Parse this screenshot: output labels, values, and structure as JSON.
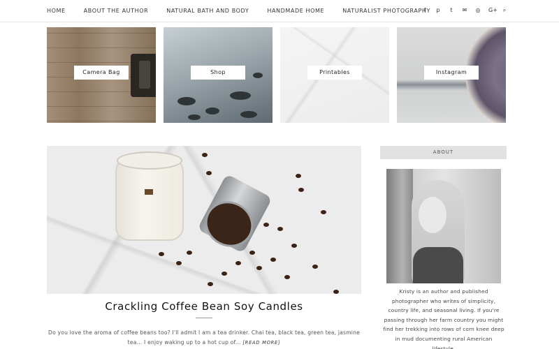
{
  "nav": {
    "items": [
      {
        "label": "HOME"
      },
      {
        "label": "ABOUT THE AUTHOR"
      },
      {
        "label": "NATURAL BATH AND BODY"
      },
      {
        "label": "HANDMADE HOME"
      },
      {
        "label": "NATURALIST PHOTOGRAPHY"
      }
    ],
    "social": [
      "f",
      "p",
      "t",
      "✉",
      "◎",
      "G+",
      "⌕"
    ]
  },
  "tiles": [
    {
      "label": "Camera Bag"
    },
    {
      "label": "Shop"
    },
    {
      "label": "Printables"
    },
    {
      "label": "Instagram"
    }
  ],
  "post": {
    "title": "Crackling Coffee Bean Soy Candles",
    "excerpt": "Do you love the aroma of coffee beans too? I'll admit I am a tea drinker. Chai tea, black tea, green tea, jasmine tea... I enjoy waking up to a hot cup of...",
    "read_more": "[READ MORE]"
  },
  "sidebar": {
    "about_heading": "ABOUT",
    "about_text": "Kristy is an author and published photographer who writes of simplicity, country life, and seasonal living. If you're passing through her farm country you might find her trekking into rows of corn knee deep in mud documenting rural American lifestyle."
  }
}
